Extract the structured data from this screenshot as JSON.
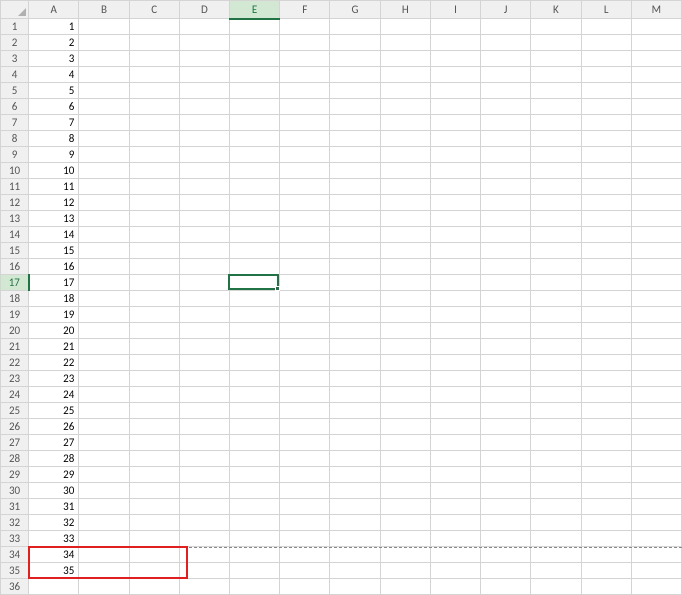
{
  "grid": {
    "columns": [
      "A",
      "B",
      "C",
      "D",
      "E",
      "F",
      "G",
      "H",
      "I",
      "J",
      "K",
      "L",
      "M"
    ],
    "rows": 36,
    "active_cell": {
      "row": 17,
      "col": "E"
    },
    "col_a_values": {
      "1": "1",
      "2": "2",
      "3": "3",
      "4": "4",
      "5": "5",
      "6": "6",
      "7": "7",
      "8": "8",
      "9": "9",
      "10": "10",
      "11": "11",
      "12": "12",
      "13": "13",
      "14": "14",
      "15": "15",
      "16": "16",
      "17": "17",
      "18": "18",
      "19": "19",
      "20": "20",
      "21": "21",
      "22": "22",
      "23": "23",
      "24": "24",
      "25": "25",
      "26": "26",
      "27": "27",
      "28": "28",
      "29": "29",
      "30": "30",
      "31": "31",
      "32": "32",
      "33": "33",
      "34": "34",
      "35": "35"
    },
    "red_annotation_rows": [
      34,
      35
    ],
    "page_break_after_row": 33
  },
  "colors": {
    "header_bg": "#f0f0f0",
    "grid_line": "#d4d4d4",
    "selection": "#217346",
    "annotation": "#e02020"
  }
}
